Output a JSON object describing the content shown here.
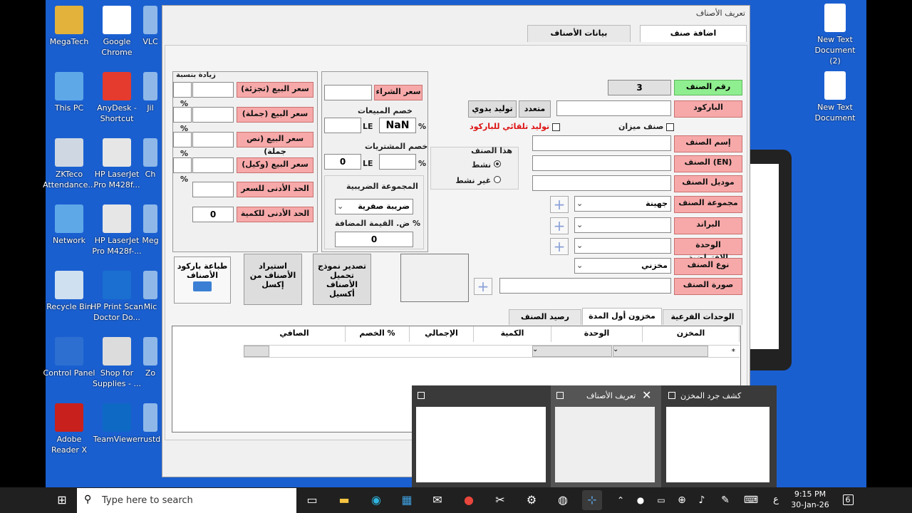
{
  "desktop": {
    "icons_left": [
      {
        "label": "MegaTech",
        "color": "#e2b23a"
      },
      {
        "label": "This PC",
        "color": "#5fa8e8"
      },
      {
        "label": "ZKTeco Attendance...",
        "color": "#cfd8e2"
      },
      {
        "label": "Network",
        "color": "#5fa8e8"
      },
      {
        "label": "Recycle Bin",
        "color": "#cfe0f0"
      },
      {
        "label": "Control Panel",
        "color": "#2d6fd0"
      },
      {
        "label": "Adobe Reader X",
        "color": "#c8201c"
      }
    ],
    "icons_mid": [
      {
        "label": "Google Chrome",
        "color": "#ffffff"
      },
      {
        "label": "AnyDesk - Shortcut",
        "color": "#e43b2e"
      },
      {
        "label": "HP LaserJet Pro M428f...",
        "color": "#e6e6e6"
      },
      {
        "label": "HP LaserJet Pro M428f-...",
        "color": "#e6e6e6"
      },
      {
        "label": "HP Print Scan Doctor Do...",
        "color": "#1a6fd0"
      },
      {
        "label": "Shop for Supplies - ...",
        "color": "#dcdcdc"
      },
      {
        "label": "TeamViewer",
        "color": "#0e69c5"
      }
    ],
    "icons_edge": [
      "VLC",
      "Jil",
      "Ch",
      "Meg",
      "Mic",
      "Zo",
      "rustd"
    ],
    "icons_right": [
      {
        "label": "New Text Document (2)"
      },
      {
        "label": "New Text Document"
      }
    ]
  },
  "window": {
    "title": "تعريف الأصناف",
    "tabs": {
      "add": "اضافة صنف",
      "data": "بيانات الأصناف"
    },
    "item_no": {
      "label": "رقم الصنف",
      "value": "3"
    },
    "barcode": {
      "label": "الباركود",
      "multi": "متعدد",
      "manual": "توليد يدوي",
      "auto": "توليد تلقائي للباركود",
      "scale": "صنف ميزان"
    },
    "name": {
      "label": "إسم الصنف"
    },
    "name_en": {
      "label": "الصنف (EN)"
    },
    "model": {
      "label": "موديل الصنف"
    },
    "group": {
      "label": "مجموعة الصنف",
      "value": "جهينة"
    },
    "brand": {
      "label": "البراند"
    },
    "unit": {
      "label": "الوحدة الافتراضية"
    },
    "type": {
      "label": "نوع الصنف",
      "value": "مخزني"
    },
    "image": {
      "label": "صورة الصنف"
    },
    "status": {
      "title": "هذا الصنف",
      "active": "نشط",
      "inactive": "غير نشط"
    },
    "purchase": {
      "label": "سعر الشراء",
      "sales_disc": "خصم المبيعات",
      "nan": "NaN",
      "le": "LE",
      "pct": "%",
      "purch_disc": "خصم المشتريات",
      "zero": "0",
      "tax_group": "المجموعة الضريبية",
      "tax_value": "ضريبة صفرية",
      "vat": "ض. القيمة المضافة %",
      "vat_value": "0"
    },
    "prices": {
      "increase": "زيادة بنسبة",
      "retail": "سعر البيع (تجزئة)",
      "wholesale": "سعر البيع (جملة)",
      "half": "سعر البيع (نص جملة)",
      "agent": "سعر البيع (وكيل)",
      "min_price": "الحد الأدنى للسعر",
      "min_qty": "الحد الأدنى للكمية",
      "min_qty_value": "0",
      "pct": "%"
    },
    "actions": {
      "print": "طباعة باركود الأصناف",
      "import": "استيراد الأصناف من إكسل",
      "export": "تصدير نموذج تحميل الأصناف أكسيل"
    },
    "subtabs": [
      "الوحدات الفرعية",
      "مخزون أول المدة",
      "رصيد الصنف"
    ],
    "grid": {
      "columns": [
        "المخزن",
        "الوحدة",
        "الكمية",
        "الإجمالي",
        "الخصم %",
        "الصافي"
      ],
      "marker": "*"
    }
  },
  "popup": {
    "cards": [
      {
        "title": "كشف جرد المخزن"
      },
      {
        "title": "تعريف الأصناف"
      },
      {
        "title": ""
      }
    ]
  },
  "taskbar": {
    "search_placeholder": "Type here to search",
    "time": "9:15 PM",
    "date": "30-Jan-26",
    "lang": "ع",
    "notif": "6"
  }
}
